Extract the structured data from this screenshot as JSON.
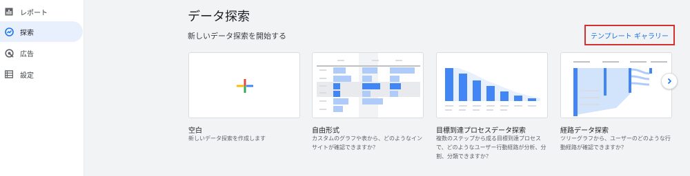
{
  "sidebar": {
    "items": [
      {
        "label": "レポート",
        "icon": "bar-chart-icon"
      },
      {
        "label": "探索",
        "icon": "explore-icon"
      },
      {
        "label": "広告",
        "icon": "ads-icon"
      },
      {
        "label": "設定",
        "icon": "settings-list-icon"
      }
    ]
  },
  "main": {
    "title": "データ探索",
    "subtitle": "新しいデータ探索を開始する",
    "gallery_label": "テンプレート ギャラリー",
    "cards": [
      {
        "title": "空白",
        "description": "新しいデータ探索を作成します"
      },
      {
        "title": "自由形式",
        "description": "カスタムのグラフや表から、どのようなインサイトが確認できますか？"
      },
      {
        "title": "目標到達プロセスデータ探索",
        "description": "複数のステップから成る目標到達プロセスで、どのようなユーザー行動経路が分析、分割、分類できますか？"
      },
      {
        "title": "経路データ探索",
        "description": "ツリーグラフから、ユーザーのどのような行動経路が確認できますか？"
      }
    ]
  },
  "colors": {
    "accent": "#1a73e8",
    "highlight_border": "#d32f2f",
    "active_nav_bg": "#e8f0fe"
  }
}
